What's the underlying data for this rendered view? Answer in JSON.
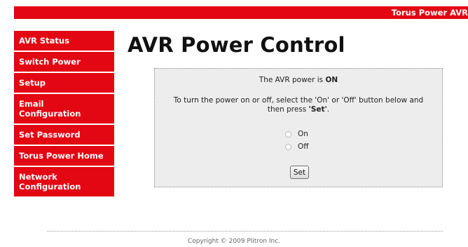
{
  "header": {
    "brand": "Torus Power AVR"
  },
  "sidebar": {
    "items": [
      {
        "lines": [
          "AVR Status"
        ]
      },
      {
        "lines": [
          "Switch Power"
        ]
      },
      {
        "lines": [
          "Setup"
        ]
      },
      {
        "lines": [
          "Email",
          "Configuration"
        ]
      },
      {
        "lines": [
          "Set Password"
        ]
      },
      {
        "lines": [
          "Torus Power Home"
        ]
      },
      {
        "lines": [
          "Network",
          "Configuration"
        ]
      }
    ]
  },
  "main": {
    "title": "AVR Power Control",
    "status_prefix": "The AVR power is ",
    "status_value": "ON",
    "instructions_text": "To turn the power on or off, select the 'On' or 'Off' button below and then press ",
    "instructions_bold": "'Set'",
    "instructions_end": ".",
    "options": [
      "On",
      "Off"
    ],
    "set_label": "Set"
  },
  "footer": {
    "copyright": "Copyright © 2009 Plitron Inc."
  },
  "colors": {
    "accent": "#e30613",
    "panel_bg": "#ededed"
  }
}
